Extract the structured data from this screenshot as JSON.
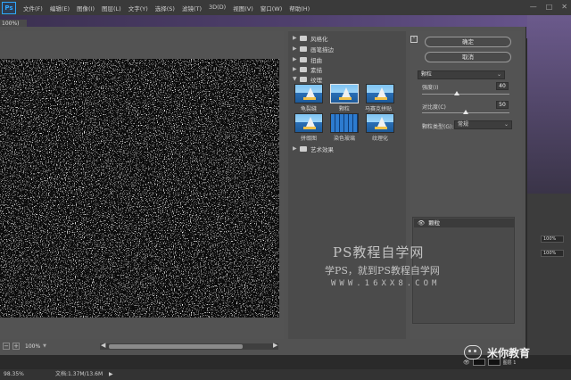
{
  "app": {
    "logo": "Ps"
  },
  "menu": [
    "文件(F)",
    "编辑(E)",
    "图像(I)",
    "图层(L)",
    "文字(Y)",
    "选择(S)",
    "滤镜(T)",
    "3D(D)",
    "视图(V)",
    "窗口(W)",
    "帮助(H)"
  ],
  "window_controls": {
    "minimize": "—",
    "maximize": "□",
    "close": "✕"
  },
  "doc_tab": "100%)",
  "canvas": {
    "zoom": "100%",
    "zoom_minus": "−",
    "zoom_plus": "+",
    "scroll_left": "◀",
    "scroll_right": "▶"
  },
  "gallery": {
    "folders_top": [
      {
        "label": "风格化",
        "arrow": "▶"
      },
      {
        "label": "画笔描边",
        "arrow": "▶"
      },
      {
        "label": "扭曲",
        "arrow": "▶"
      },
      {
        "label": "素描",
        "arrow": "▶"
      },
      {
        "label": "纹理",
        "arrow": "▼"
      }
    ],
    "thumbs": [
      {
        "label": "龟裂缝",
        "selected": false,
        "style": "sail"
      },
      {
        "label": "颗粒",
        "selected": true,
        "style": "sail"
      },
      {
        "label": "马赛克拼贴",
        "selected": false,
        "style": "sail"
      },
      {
        "label": "拼缀图",
        "selected": false,
        "style": "sail"
      },
      {
        "label": "染色玻璃",
        "selected": false,
        "style": "tiles"
      },
      {
        "label": "纹理化",
        "selected": false,
        "style": "sail"
      }
    ],
    "folder_bottom": {
      "label": "艺术效果",
      "arrow": "▶"
    }
  },
  "settings": {
    "collapse": "⌃",
    "ok": "确定",
    "cancel": "取消",
    "filter_select": "颗粒",
    "intensity_label": "强度(I)",
    "intensity_value": "40",
    "intensity_fraction": 0.4,
    "contrast_label": "对比度(C)",
    "contrast_value": "50",
    "contrast_fraction": 0.5,
    "grain_type_label": "颗粒类型(G):",
    "grain_type_value": "常规",
    "dropdown_arrow": "⌄"
  },
  "layers": {
    "item": "颗粒",
    "eye": "👁"
  },
  "watermark": {
    "line1": "PS教程自学网",
    "line2": "学PS，就到PS教程自学网",
    "line3": "WWW.16XX8.COM"
  },
  "right_panel": {
    "opacity1": "100%",
    "opacity2": "100%"
  },
  "status": {
    "zoom": "98.35%",
    "doc": "文档:1.37M/13.6M",
    "arrow": "▶"
  },
  "badge": {
    "text": "米你教育"
  },
  "layer_strip": {
    "label": "图层 1"
  }
}
